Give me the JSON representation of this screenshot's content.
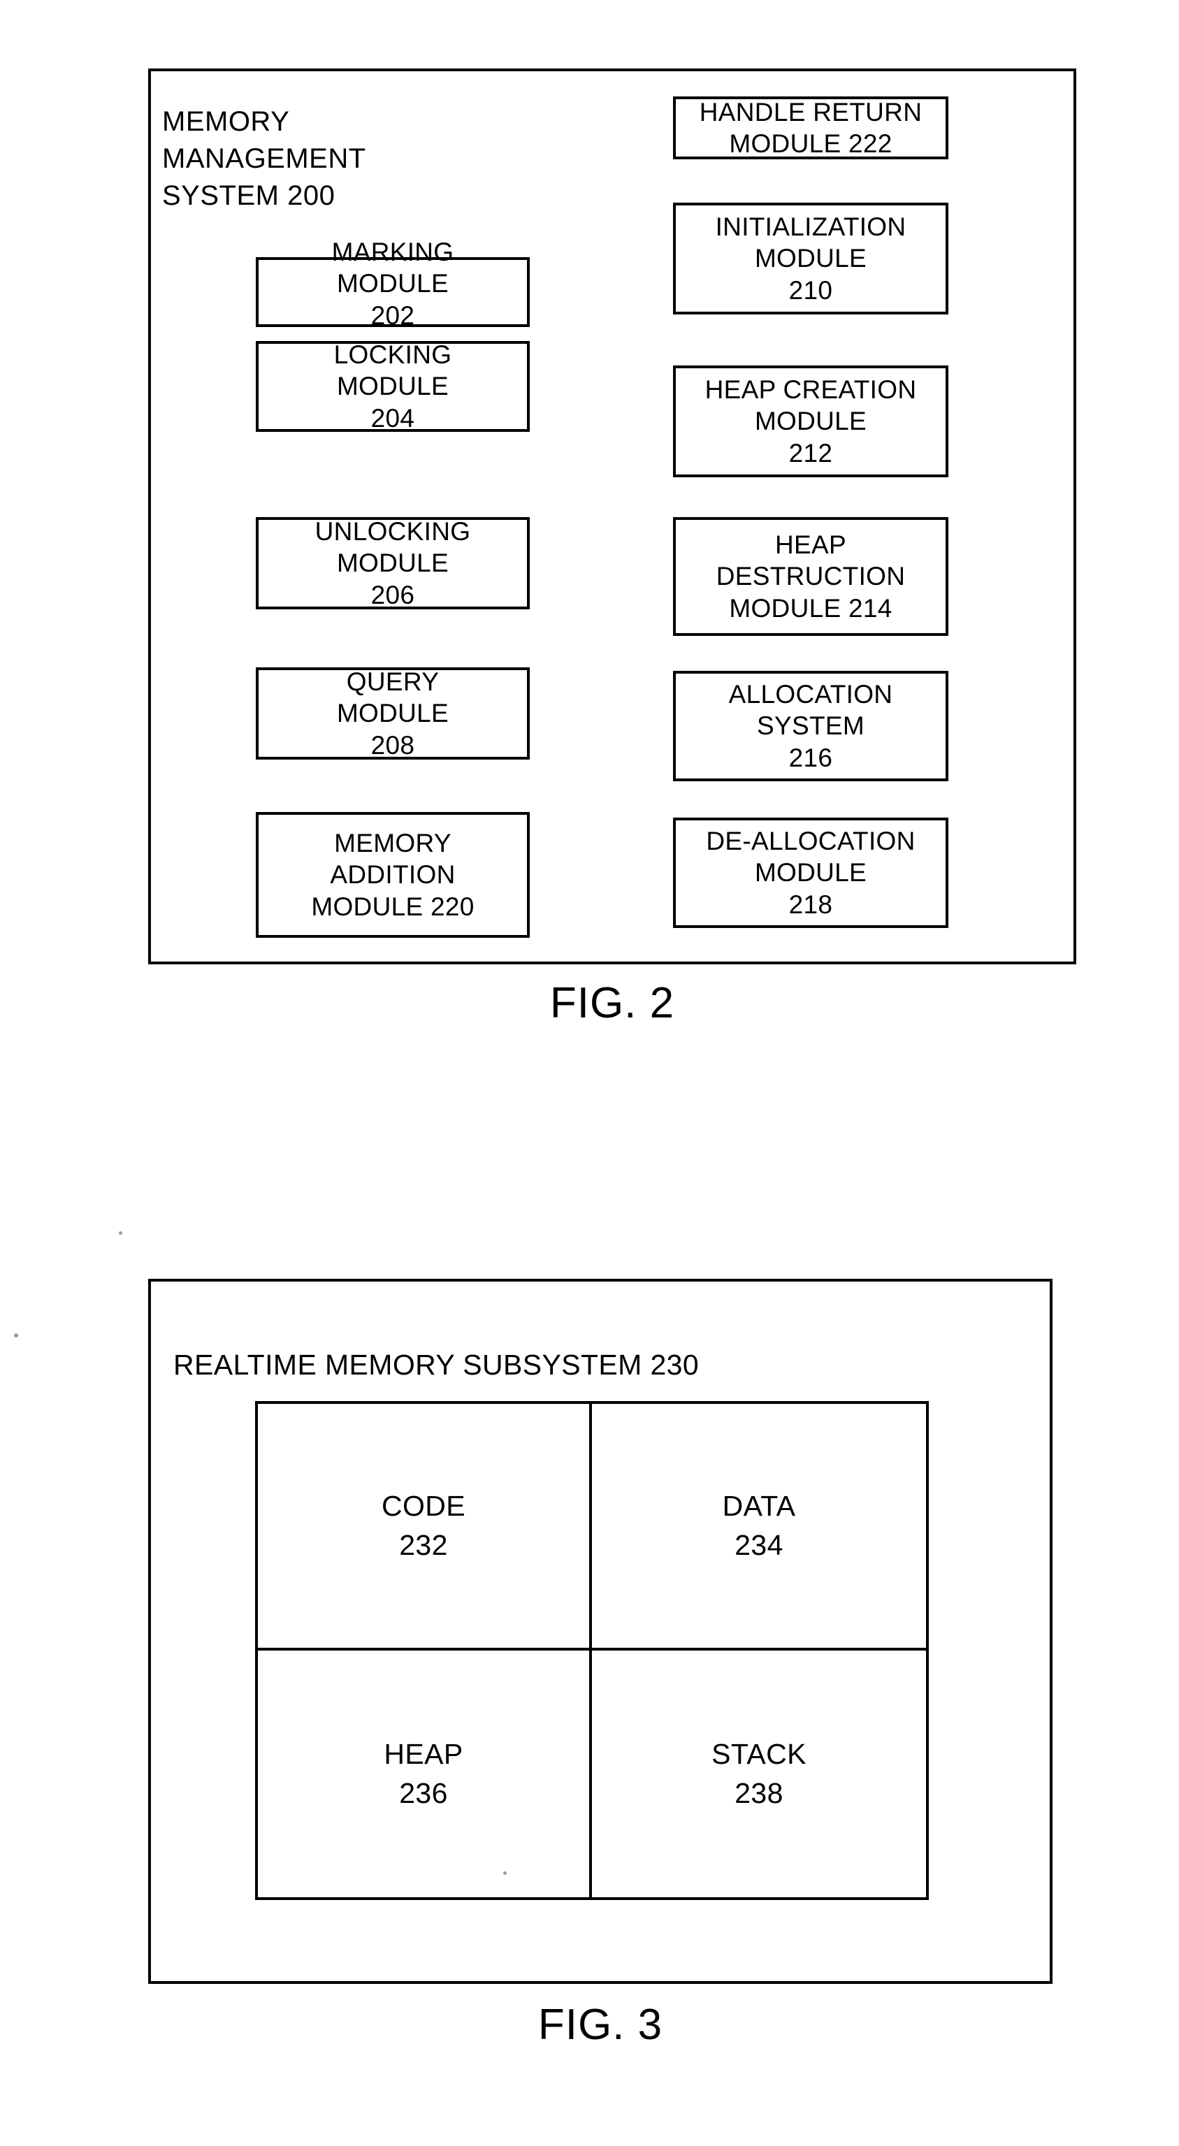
{
  "figure2": {
    "caption": "FIG. 2",
    "title": "MEMORY\nMANAGEMENT\nSYSTEM 200",
    "left_column": [
      {
        "label": "MARKING\nMODULE\n202",
        "ref": "202",
        "name": "marking-module"
      },
      {
        "label": "LOCKING\nMODULE\n204",
        "ref": "204",
        "name": "locking-module"
      },
      {
        "label": "UNLOCKING\nMODULE\n206",
        "ref": "206",
        "name": "unlocking-module"
      },
      {
        "label": "QUERY\nMODULE\n208",
        "ref": "208",
        "name": "query-module"
      },
      {
        "label": "MEMORY\nADDITION\nMODULE 220",
        "ref": "220",
        "name": "memory-addition-module"
      }
    ],
    "right_column": [
      {
        "label": "HANDLE RETURN\nMODULE 222",
        "ref": "222",
        "name": "handle-return-module"
      },
      {
        "label": "INITIALIZATION\nMODULE\n210",
        "ref": "210",
        "name": "initialization-module"
      },
      {
        "label": "HEAP CREATION\nMODULE\n212",
        "ref": "212",
        "name": "heap-creation-module"
      },
      {
        "label": "HEAP\nDESTRUCTION\nMODULE 214",
        "ref": "214",
        "name": "heap-destruction-module"
      },
      {
        "label": "ALLOCATION\nSYSTEM\n216",
        "ref": "216",
        "name": "allocation-system"
      },
      {
        "label": "DE-ALLOCATION\nMODULE\n218",
        "ref": "218",
        "name": "de-allocation-module"
      }
    ]
  },
  "figure3": {
    "caption": "FIG. 3",
    "title": "REALTIME MEMORY SUBSYSTEM 230",
    "cells": [
      {
        "label": "CODE\n232",
        "ref": "232",
        "name": "code-region"
      },
      {
        "label": "DATA\n234",
        "ref": "234",
        "name": "data-region"
      },
      {
        "label": "HEAP\n236",
        "ref": "236",
        "name": "heap-region"
      },
      {
        "label": "STACK\n238",
        "ref": "238",
        "name": "stack-region"
      }
    ]
  },
  "style": {
    "ink": "#000000",
    "paper": "#ffffff"
  }
}
